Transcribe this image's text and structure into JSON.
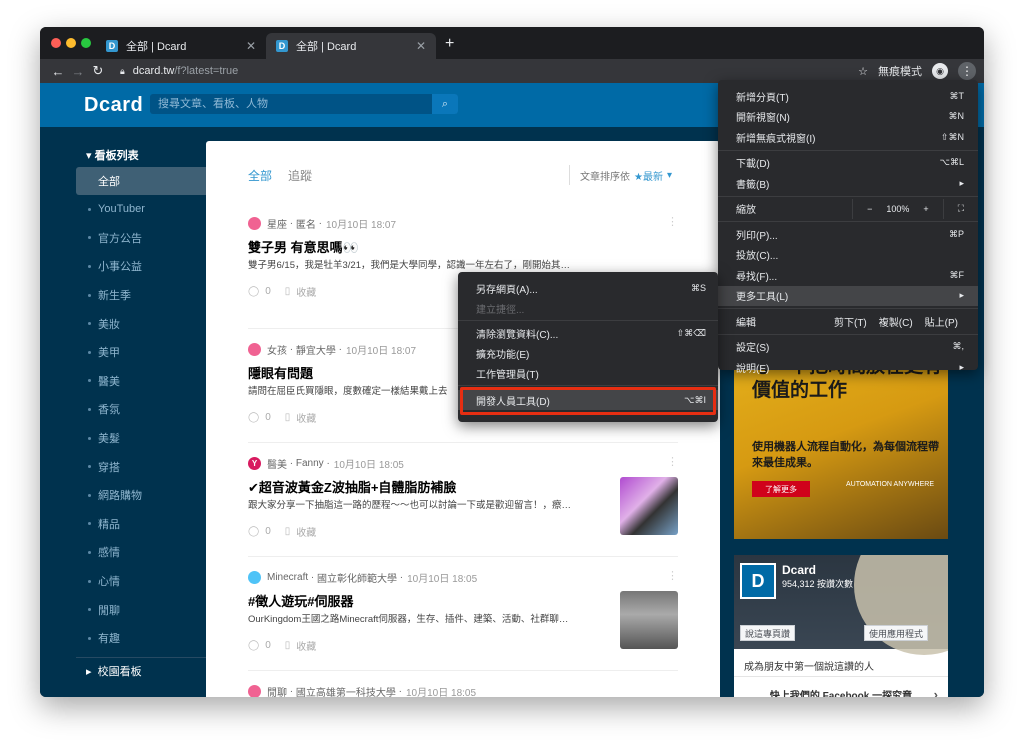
{
  "browser": {
    "tabs": [
      {
        "title": "全部 | Dcard",
        "favicon": "D",
        "active": false
      },
      {
        "title": "全部 | Dcard",
        "favicon": "D",
        "active": true
      }
    ],
    "url_host": "dcard.tw",
    "url_path": "/f?latest=true",
    "incognito_label": "無痕模式"
  },
  "site": {
    "logo": "Dcard",
    "search_placeholder": "搜尋文章、看板、人物"
  },
  "sidebar": {
    "header": "看板列表",
    "items": [
      "全部",
      "YouTuber",
      "官方公告",
      "小事公益",
      "新生季",
      "美妝",
      "美甲",
      "醫美",
      "香氛",
      "美髮",
      "穿搭",
      "網路購物",
      "精品",
      "感情",
      "心情",
      "閒聊",
      "有趣"
    ],
    "footer": "校園看板"
  },
  "feed": {
    "tabs": [
      "全部",
      "追蹤"
    ],
    "sort_label": "文章排序依",
    "sort_value": "★最新",
    "posts": [
      {
        "board": "星座",
        "author": "匿名",
        "time": "10月10日 18:07",
        "title": "雙子男 有意思嗎👀",
        "excerpt": "雙子男6/15，我是牡羊3/21，我們是大學同學，認識一年左右了，剛開始其…",
        "likes": "0",
        "save": "收藏",
        "avatar_color": "#f06292"
      },
      {
        "board": "女孩",
        "author": "靜宜大學",
        "time": "10月10日 18:07",
        "title": "隱眼有問題",
        "excerpt": "請問在屈臣氏買隱眼，度數確定一樣結果戴上去…",
        "likes": "0",
        "save": "收藏",
        "avatar_color": "#f06292"
      },
      {
        "board": "醫美",
        "author": "Fanny",
        "time": "10月10日 18:05",
        "title": "✔超音波黃金Z波抽脂+自體脂肪補臉",
        "excerpt": "跟大家分享一下抽脂這一路的歷程～～也可以討論一下或是歡迎留言！，瘵…",
        "likes": "0",
        "save": "收藏",
        "avatar_color": "#d81b60"
      },
      {
        "board": "Minecraft",
        "author": "國立彰化師範大學",
        "time": "10月10日 18:05",
        "title": "#徵人遊玩#伺服器",
        "excerpt": "OurKingdom王國之路Minecraft伺服器，生存、插件、建築、活動、社群聊…",
        "likes": "0",
        "save": "收藏",
        "avatar_color": "#4fc3f7"
      },
      {
        "board": "閒聊",
        "author": "國立高雄第一科技大學",
        "time": "10月10日 18:05",
        "title": "",
        "excerpt": "",
        "likes": "",
        "save": "",
        "avatar_color": "#f06292"
      }
    ]
  },
  "ad": {
    "headline": "與其暗忙一場，不如思考一下把時間放在更有價值的工作",
    "body": "使用機器人流程自動化，為每個流程帶來最佳成果。",
    "button": "了解更多",
    "brand": "AUTOMATION ANYWHERE"
  },
  "facebook": {
    "name": "Dcard",
    "likes": "954,312 按讚次數",
    "like_button": "說這專頁讚",
    "app_button": "使用應用程式",
    "first_friend": "成為朋友中第一個說這讚的人",
    "cta": "快上我們的 Facebook 一探究竟"
  },
  "chrome_menu": {
    "items": [
      {
        "label": "新增分頁(T)",
        "shortcut": "⌘T"
      },
      {
        "label": "開新視窗(N)",
        "shortcut": "⌘N"
      },
      {
        "label": "新增無痕式視窗(I)",
        "shortcut": "⇧⌘N"
      },
      {
        "label": "下載(D)",
        "shortcut": "⌥⌘L"
      },
      {
        "label": "書籤(B)",
        "shortcut": "▸"
      },
      {
        "label": "縮放",
        "shortcut": ""
      },
      {
        "label": "列印(P)...",
        "shortcut": "⌘P"
      },
      {
        "label": "投放(C)...",
        "shortcut": ""
      },
      {
        "label": "尋找(F)...",
        "shortcut": "⌘F"
      },
      {
        "label": "更多工具(L)",
        "shortcut": "▸"
      },
      {
        "label": "編輯",
        "shortcut": ""
      },
      {
        "label": "設定(S)",
        "shortcut": "⌘,"
      },
      {
        "label": "說明(E)",
        "shortcut": "▸"
      }
    ],
    "zoom": {
      "minus": "−",
      "value": "100%",
      "plus": "+",
      "fullscreen": "⛶"
    },
    "edit": {
      "cut": "剪下(T)",
      "copy": "複製(C)",
      "paste": "貼上(P)"
    }
  },
  "more_tools_menu": {
    "items": [
      {
        "label": "另存網頁(A)...",
        "shortcut": "⌘S"
      },
      {
        "label": "建立捷徑...",
        "shortcut": ""
      },
      {
        "label": "清除瀏覽資料(C)...",
        "shortcut": "⇧⌘⌫"
      },
      {
        "label": "擴充功能(E)",
        "shortcut": ""
      },
      {
        "label": "工作管理員(T)",
        "shortcut": ""
      },
      {
        "label": "開發人員工具(D)",
        "shortcut": "⌥⌘I"
      }
    ]
  }
}
